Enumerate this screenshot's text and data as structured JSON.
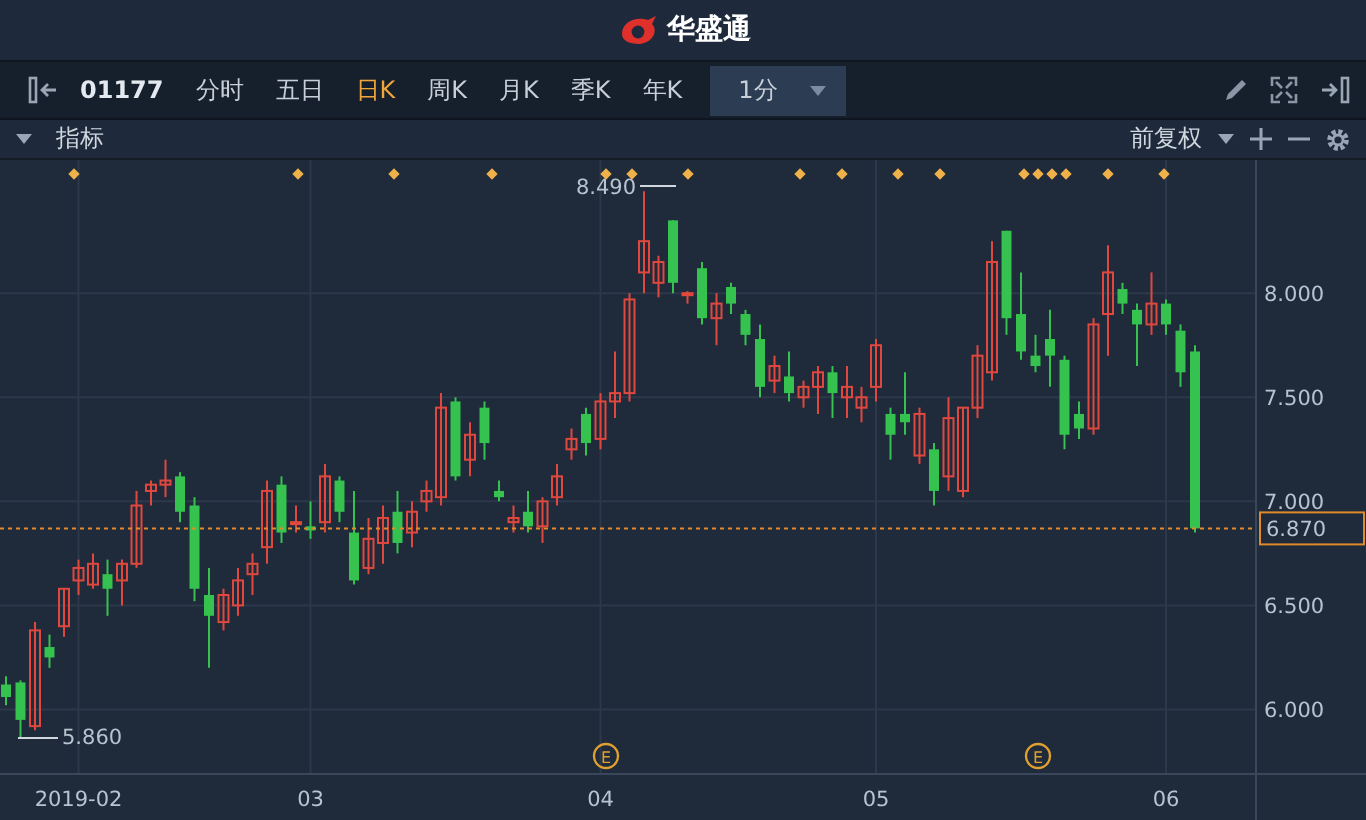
{
  "app_title": "华盛通",
  "toolbar": {
    "symbol": "01177",
    "periods": [
      {
        "label": "分时",
        "selected": false
      },
      {
        "label": "五日",
        "selected": false
      },
      {
        "label": "日K",
        "selected": true
      },
      {
        "label": "周K",
        "selected": false
      },
      {
        "label": "月K",
        "selected": false
      },
      {
        "label": "季K",
        "selected": false
      },
      {
        "label": "年K",
        "selected": false
      }
    ],
    "interval": "1分"
  },
  "indicator_bar": {
    "label": "指标",
    "adjustment": "前复权"
  },
  "chart": {
    "high_label": "8.490",
    "low_label": "5.860",
    "earnings_marks": [
      "E",
      "E"
    ],
    "chart_data": {
      "type": "candlestick",
      "ylim": [
        5.69,
        8.64
      ],
      "grid": true,
      "ref_lines": [
        {
          "axis": "y",
          "value": 6.87,
          "label": "6.870",
          "color": "#e08a2a"
        }
      ],
      "yticks": [
        {
          "value": 8,
          "label": "8.000"
        },
        {
          "value": 7.5,
          "label": "7.500"
        },
        {
          "value": 7,
          "label": "7.000"
        },
        {
          "value": 6.5,
          "label": "6.500"
        },
        {
          "value": 6,
          "label": "6.000"
        }
      ],
      "categories": [
        null,
        null,
        null,
        null,
        null,
        "2019-02",
        null,
        null,
        null,
        null,
        null,
        null,
        null,
        null,
        null,
        null,
        null,
        null,
        null,
        null,
        null,
        "03",
        null,
        null,
        null,
        null,
        null,
        null,
        null,
        null,
        null,
        null,
        null,
        null,
        null,
        null,
        null,
        null,
        null,
        null,
        null,
        "04",
        null,
        null,
        null,
        null,
        null,
        null,
        null,
        null,
        null,
        null,
        null,
        null,
        null,
        null,
        null,
        null,
        null,
        null,
        "05",
        null,
        null,
        null,
        null,
        null,
        null,
        null,
        null,
        null,
        null,
        null,
        null,
        null,
        null,
        null,
        null,
        null,
        null,
        null,
        "06",
        null,
        null
      ],
      "ohlc": [
        [
          6.12,
          6.16,
          6.02,
          6.06
        ],
        [
          6.13,
          6.14,
          5.86,
          5.95
        ],
        [
          5.92,
          6.42,
          5.9,
          6.38
        ],
        [
          6.3,
          6.36,
          6.2,
          6.25
        ],
        [
          6.4,
          6.58,
          6.35,
          6.58
        ],
        [
          6.62,
          6.72,
          6.55,
          6.68
        ],
        [
          6.6,
          6.75,
          6.58,
          6.7
        ],
        [
          6.65,
          6.72,
          6.45,
          6.58
        ],
        [
          6.62,
          6.72,
          6.5,
          6.7
        ],
        [
          6.7,
          7.05,
          6.68,
          6.98
        ],
        [
          7.05,
          7.1,
          6.98,
          7.08
        ],
        [
          7.08,
          7.2,
          7.02,
          7.1
        ],
        [
          7.12,
          7.14,
          6.9,
          6.95
        ],
        [
          6.98,
          7.02,
          6.52,
          6.58
        ],
        [
          6.55,
          6.68,
          6.2,
          6.45
        ],
        [
          6.42,
          6.58,
          6.38,
          6.55
        ],
        [
          6.5,
          6.68,
          6.45,
          6.62
        ],
        [
          6.65,
          6.75,
          6.55,
          6.7
        ],
        [
          6.78,
          7.1,
          6.7,
          7.05
        ],
        [
          7.08,
          7.12,
          6.8,
          6.85
        ],
        [
          6.9,
          6.98,
          6.85,
          6.9
        ],
        [
          6.88,
          7.0,
          6.82,
          6.86
        ],
        [
          6.9,
          7.18,
          6.85,
          7.12
        ],
        [
          7.1,
          7.12,
          6.9,
          6.95
        ],
        [
          6.85,
          7.05,
          6.6,
          6.62
        ],
        [
          6.68,
          6.92,
          6.65,
          6.82
        ],
        [
          6.8,
          6.98,
          6.7,
          6.92
        ],
        [
          6.95,
          7.05,
          6.75,
          6.8
        ],
        [
          6.85,
          7.0,
          6.78,
          6.95
        ],
        [
          7.0,
          7.1,
          6.95,
          7.05
        ],
        [
          7.02,
          7.52,
          6.98,
          7.45
        ],
        [
          7.48,
          7.5,
          7.1,
          7.12
        ],
        [
          7.2,
          7.38,
          7.12,
          7.32
        ],
        [
          7.45,
          7.48,
          7.2,
          7.28
        ],
        [
          7.05,
          7.1,
          7.0,
          7.02
        ],
        [
          6.9,
          6.98,
          6.85,
          6.92
        ],
        [
          6.95,
          7.05,
          6.85,
          6.88
        ],
        [
          6.88,
          7.02,
          6.8,
          7.0
        ],
        [
          7.02,
          7.18,
          6.98,
          7.12
        ],
        [
          7.25,
          7.35,
          7.2,
          7.3
        ],
        [
          7.42,
          7.45,
          7.22,
          7.28
        ],
        [
          7.3,
          7.52,
          7.25,
          7.48
        ],
        [
          7.48,
          7.72,
          7.4,
          7.52
        ],
        [
          7.52,
          8.0,
          7.48,
          7.97
        ],
        [
          8.1,
          8.49,
          8.0,
          8.25
        ],
        [
          8.05,
          8.18,
          7.98,
          8.15
        ],
        [
          8.35,
          8.35,
          8.0,
          8.05
        ],
        [
          8.0,
          8.01,
          7.95,
          8.0
        ],
        [
          8.12,
          8.15,
          7.85,
          7.88
        ],
        [
          7.88,
          8.0,
          7.75,
          7.95
        ],
        [
          8.03,
          8.05,
          7.9,
          7.95
        ],
        [
          7.9,
          7.92,
          7.75,
          7.8
        ],
        [
          7.78,
          7.85,
          7.5,
          7.55
        ],
        [
          7.58,
          7.7,
          7.52,
          7.65
        ],
        [
          7.6,
          7.72,
          7.48,
          7.52
        ],
        [
          7.5,
          7.58,
          7.45,
          7.55
        ],
        [
          7.55,
          7.65,
          7.42,
          7.62
        ],
        [
          7.62,
          7.65,
          7.4,
          7.52
        ],
        [
          7.5,
          7.65,
          7.4,
          7.55
        ],
        [
          7.45,
          7.55,
          7.38,
          7.5
        ],
        [
          7.55,
          7.78,
          7.48,
          7.75
        ],
        [
          7.42,
          7.45,
          7.2,
          7.32
        ],
        [
          7.42,
          7.62,
          7.32,
          7.38
        ],
        [
          7.22,
          7.45,
          7.18,
          7.42
        ],
        [
          7.25,
          7.28,
          6.98,
          7.05
        ],
        [
          7.12,
          7.5,
          7.05,
          7.4
        ],
        [
          7.05,
          7.45,
          7.02,
          7.45
        ],
        [
          7.45,
          7.75,
          7.4,
          7.7
        ],
        [
          7.62,
          8.25,
          7.58,
          8.15
        ],
        [
          8.3,
          8.3,
          7.8,
          7.88
        ],
        [
          7.9,
          8.1,
          7.68,
          7.72
        ],
        [
          7.7,
          7.8,
          7.62,
          7.65
        ],
        [
          7.78,
          7.92,
          7.55,
          7.7
        ],
        [
          7.68,
          7.7,
          7.25,
          7.32
        ],
        [
          7.42,
          7.48,
          7.3,
          7.35
        ],
        [
          7.35,
          7.88,
          7.32,
          7.85
        ],
        [
          7.9,
          8.23,
          7.7,
          8.1
        ],
        [
          8.02,
          8.05,
          7.9,
          7.95
        ],
        [
          7.92,
          7.95,
          7.65,
          7.85
        ],
        [
          7.85,
          8.1,
          7.8,
          7.95
        ],
        [
          7.95,
          7.97,
          7.8,
          7.85
        ],
        [
          7.82,
          7.85,
          7.55,
          7.62
        ],
        [
          7.72,
          7.75,
          6.85,
          6.87
        ]
      ]
    }
  }
}
